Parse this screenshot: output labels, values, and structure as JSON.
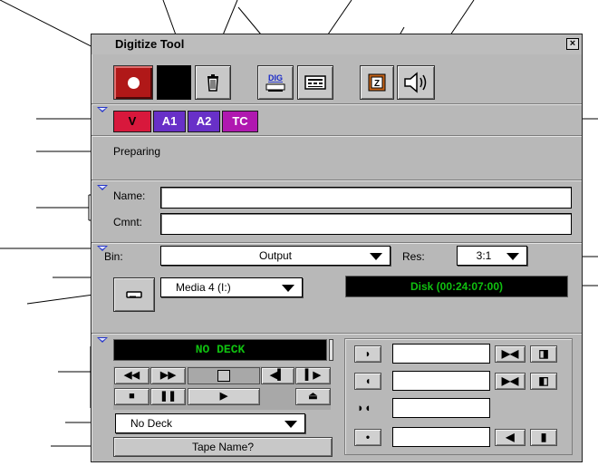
{
  "window": {
    "title": "Digitize Tool",
    "close_glyph": "×"
  },
  "toolbar": [
    {
      "name": "record-button",
      "icon": "record-dot-icon"
    },
    {
      "name": "stop-button",
      "icon": "black-square-icon"
    },
    {
      "name": "trash-button",
      "icon": "trash-icon"
    },
    {
      "name": "dig-toggle-button",
      "icon": "dig-deck-icon",
      "text": "DIG"
    },
    {
      "name": "deck-config-button",
      "icon": "deck-icon"
    },
    {
      "name": "audio-tool-button",
      "icon": "audio-meter-icon"
    },
    {
      "name": "speaker-button",
      "icon": "speaker-icon"
    }
  ],
  "tracks": [
    {
      "label": "V",
      "color": "#d8183c",
      "text_color": "#000000"
    },
    {
      "label": "A1",
      "color": "#6830c8",
      "text_color": "#ffffff"
    },
    {
      "label": "A2",
      "color": "#6830c8",
      "text_color": "#ffffff"
    },
    {
      "label": "TC",
      "color": "#b018b0",
      "text_color": "#ffffff"
    }
  ],
  "status_text": "Preparing",
  "name_label": "Name:",
  "name_value": "",
  "comment_label": "Cmnt:",
  "comment_value": "",
  "bin_label": "Bin:",
  "bin_value": "Output",
  "res_label": "Res:",
  "res_value": "3:1",
  "target_drive": "Media 4 (I:)",
  "disk_status": "Disk (00:24:07:00)",
  "deck_display": "NO DECK",
  "deck_select": "No Deck",
  "tape_name_button": "Tape Name?",
  "deck_controls": [
    {
      "name": "rewind-button",
      "glyph": "◀◀"
    },
    {
      "name": "fast-forward-button",
      "glyph": "▶▶"
    },
    {
      "name": "step-back-button",
      "glyph": "◀▍"
    },
    {
      "name": "step-forward-button",
      "glyph": "▍▶"
    },
    {
      "name": "stop-deck-button",
      "glyph": "■"
    },
    {
      "name": "pause-button",
      "glyph": "❚❚"
    },
    {
      "name": "play-button",
      "glyph": "▶"
    },
    {
      "name": "eject-button",
      "glyph": "⏏"
    }
  ],
  "mark_controls": [
    {
      "name": "mark-in-button",
      "glyph": "◗"
    },
    {
      "name": "mark-out-button",
      "glyph": "◖"
    },
    {
      "name": "duration-button",
      "glyph": "◗◖"
    },
    {
      "name": "camroll-button",
      "glyph": "•"
    }
  ],
  "go_controls": [
    {
      "name": "go-to-in-button",
      "glyph": "▶◀"
    },
    {
      "name": "clear-in-button",
      "glyph": "◨"
    },
    {
      "name": "go-to-out-button",
      "glyph": "▶◀"
    },
    {
      "name": "clear-out-button",
      "glyph": "◧"
    },
    {
      "name": "go-to-start-button",
      "glyph": "◀"
    },
    {
      "name": "clear-all-button",
      "glyph": "▮"
    }
  ]
}
